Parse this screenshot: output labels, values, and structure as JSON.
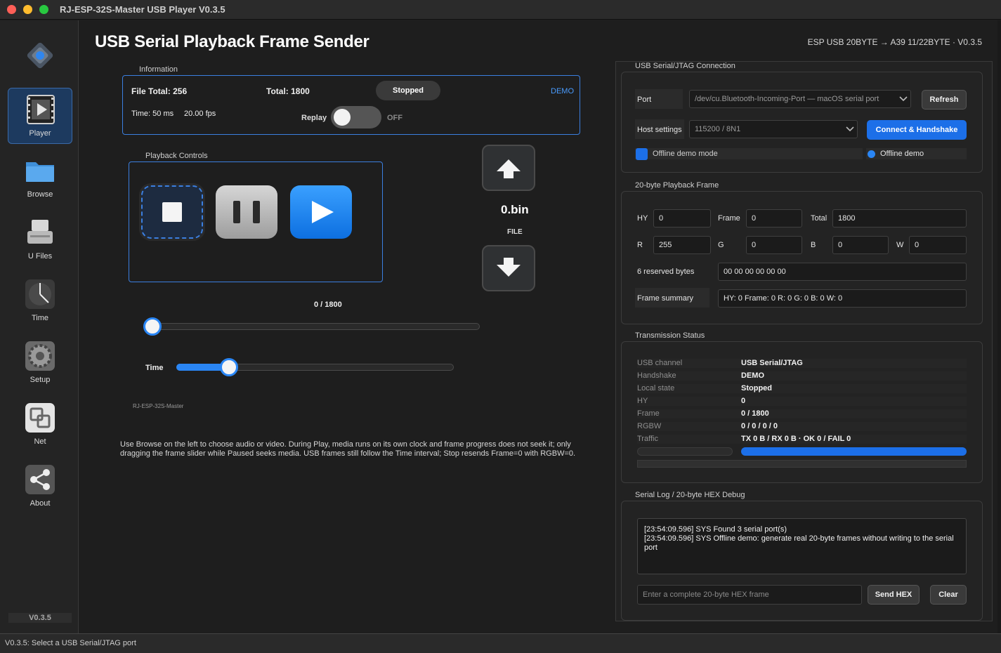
{
  "window": {
    "title": "RJ-ESP-32S-Master USB Player V0.3.5"
  },
  "sidebar": {
    "items": [
      {
        "label": "Player",
        "icon": "film-play-icon",
        "active": true
      },
      {
        "label": "Browse",
        "icon": "folder-icon"
      },
      {
        "label": "U Files",
        "icon": "usb-drive-icon"
      },
      {
        "label": "Time",
        "icon": "clock-icon"
      },
      {
        "label": "Setup",
        "icon": "gear-icon"
      },
      {
        "label": "Net",
        "icon": "network-icon"
      },
      {
        "label": "About",
        "icon": "share-icon"
      }
    ],
    "version": "V0.3.5"
  },
  "header": {
    "title": "USB Serial Playback Frame Sender",
    "subtitle": "ESP USB 20BYTE → A39 11/22BYTE · V0.3.5"
  },
  "information": {
    "group_title": "Information",
    "file_total": "File Total: 256",
    "total": "Total: 1800",
    "state_pill": "Stopped",
    "demo_label": "DEMO",
    "time_text": "Time: 50 ms",
    "fps_text": "20.00 fps",
    "replay_label": "Replay",
    "replay_state": "OFF",
    "replay_on": false
  },
  "playback": {
    "group_title": "Playback Controls",
    "file_name": "0.bin",
    "file_caption": "FILE",
    "frame_counter": "0 / 1800",
    "frame_progress": 0,
    "time_label": "Time",
    "time_progress": 0.19,
    "device_label": "RJ-ESP-32S-Master"
  },
  "help_text": "Use Browse on the left to choose audio or video. During Play, media runs on its own clock and frame progress does not seek it; only dragging the frame slider while Paused seeks media. USB frames still follow the Time interval; Stop resends Frame=0 with RGBW=0.",
  "connection": {
    "group_title": "USB Serial/JTAG Connection",
    "port_label": "Port",
    "port_value": "/dev/cu.Bluetooth-Incoming-Port — macOS serial port",
    "refresh_label": "Refresh",
    "host_label": "Host settings",
    "host_value": "115200 / 8N1",
    "connect_label": "Connect & Handshake",
    "offline_mode_label": "Offline demo mode",
    "offline_status_label": "Offline demo"
  },
  "frame": {
    "group_title": "20-byte Playback Frame",
    "hy_label": "HY",
    "hy_value": "0",
    "frame_label": "Frame",
    "frame_value": "0",
    "total_label": "Total",
    "total_value": "1800",
    "r_label": "R",
    "r_value": "255",
    "g_label": "G",
    "g_value": "0",
    "b_label": "B",
    "b_value": "0",
    "w_label": "W",
    "w_value": "0",
    "reserved_label": "6 reserved bytes",
    "reserved_value": "00 00 00 00 00 00",
    "summary_label": "Frame summary",
    "summary_value": "HY: 0  Frame: 0  R: 0  G: 0  B: 0  W: 0"
  },
  "transmission": {
    "group_title": "Transmission Status",
    "rows": [
      {
        "key": "USB channel",
        "value": "USB Serial/JTAG"
      },
      {
        "key": "Handshake",
        "value": "DEMO"
      },
      {
        "key": "Local state",
        "value": "Stopped"
      },
      {
        "key": "HY",
        "value": "0"
      },
      {
        "key": "Frame",
        "value": "0 / 1800"
      },
      {
        "key": "RGBW",
        "value": "0 / 0 / 0 / 0"
      },
      {
        "key": "Traffic",
        "value": "TX 0 B / RX 0 B · OK 0 / FAIL 0"
      }
    ],
    "progress": 1.0
  },
  "serial_log": {
    "group_title": "Serial Log / 20-byte HEX Debug",
    "lines": [
      "[23:54:09.596] SYS   Found 3 serial port(s)",
      "[23:54:09.596] SYS   Offline demo: generate real 20-byte frames without writing to the serial port"
    ],
    "hex_placeholder": "Enter a complete 20-byte HEX frame",
    "send_label": "Send HEX",
    "clear_label": "Clear"
  },
  "statusbar": {
    "text": "V0.3.5: Select a USB Serial/JTAG port"
  },
  "colors": {
    "accent": "#2a86f5",
    "primary_button": "#1c6fe8",
    "background": "#1e1e1e"
  }
}
